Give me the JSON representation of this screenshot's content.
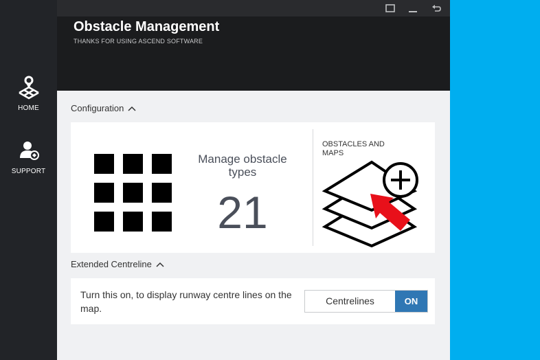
{
  "sidebar": {
    "items": [
      {
        "label": "HOME",
        "icon": "home-map-pin-icon"
      },
      {
        "label": "SUPPORT",
        "icon": "support-user-icon"
      }
    ]
  },
  "window_controls": [
    "maximize-icon",
    "minimize-icon",
    "back-icon"
  ],
  "header": {
    "title": "Obstacle Management",
    "subtitle": "THANKS FOR USING ASCEND SOFTWARE"
  },
  "configuration": {
    "heading": "Configuration",
    "manage_title": "Manage obstacle types",
    "obstacle_type_count": "21",
    "obstacles_maps_label": "OBSTACLES AND MAPS"
  },
  "extended_centreline": {
    "heading": "Extended Centreline",
    "description": "Turn this on, to display runway centre lines on the map.",
    "toggle_label": "Centrelines",
    "toggle_state": "ON"
  },
  "colors": {
    "sidebar_bg": "#222428",
    "header_bg": "#1b1c1e",
    "content_bg": "#f0f1f3",
    "accent_blue": "#2f77b4",
    "right_panel": "#00aeef",
    "arrow_red": "#e8101a"
  }
}
